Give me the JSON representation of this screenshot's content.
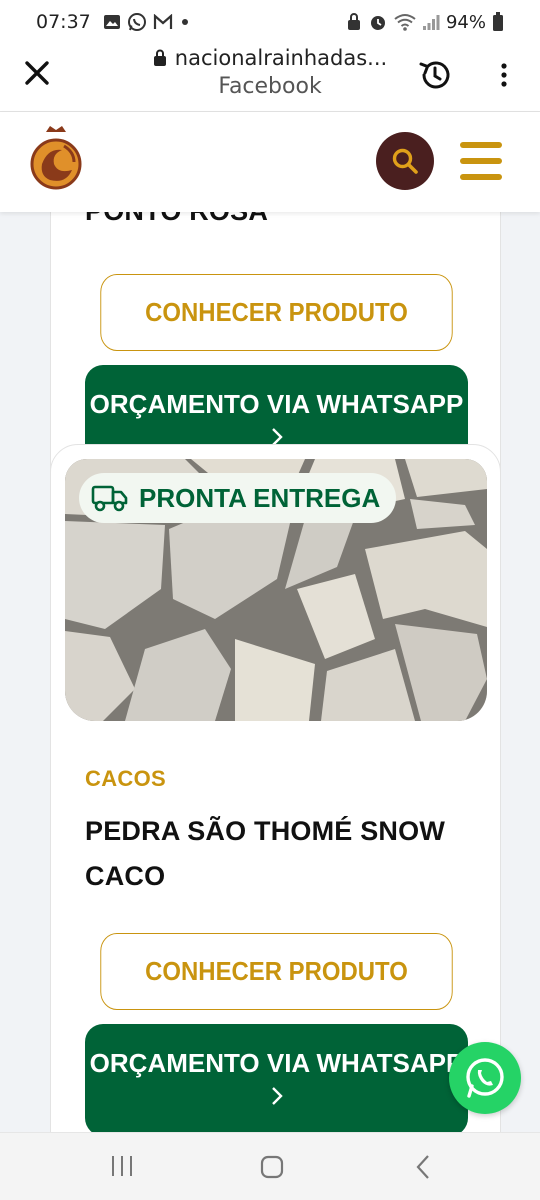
{
  "status_bar": {
    "time": "07:37",
    "battery": "94%",
    "left_icons": [
      "gallery-icon",
      "whatsapp-icon",
      "gmail-icon",
      "dot-icon"
    ],
    "right_icons": [
      "lock-icon",
      "alarm-icon",
      "wifi-icon",
      "signal-icon",
      "battery-icon"
    ]
  },
  "browser": {
    "url": "nacionalrainhadas...",
    "source": "Facebook"
  },
  "header": {
    "brand_color": "#c9940f",
    "search_bg": "#4a1f1f"
  },
  "products": [
    {
      "name": "PONTO ROSA",
      "conhecer_label": "CONHECER PRODUTO",
      "whatsapp_label": "ORÇAMENTO VIA WHATSAPP"
    },
    {
      "badge": "PRONTA ENTREGA",
      "category": "CACOS",
      "name_line1": "PEDRA SÃO THOMÉ SNOW",
      "name_line2": "CACO",
      "conhecer_label": "CONHECER PRODUTO",
      "whatsapp_label": "ORÇAMENTO VIA WHATSAPP"
    }
  ],
  "colors": {
    "accent_gold": "#c9940f",
    "whatsapp_green": "#006337",
    "float_green": "#25d366"
  }
}
